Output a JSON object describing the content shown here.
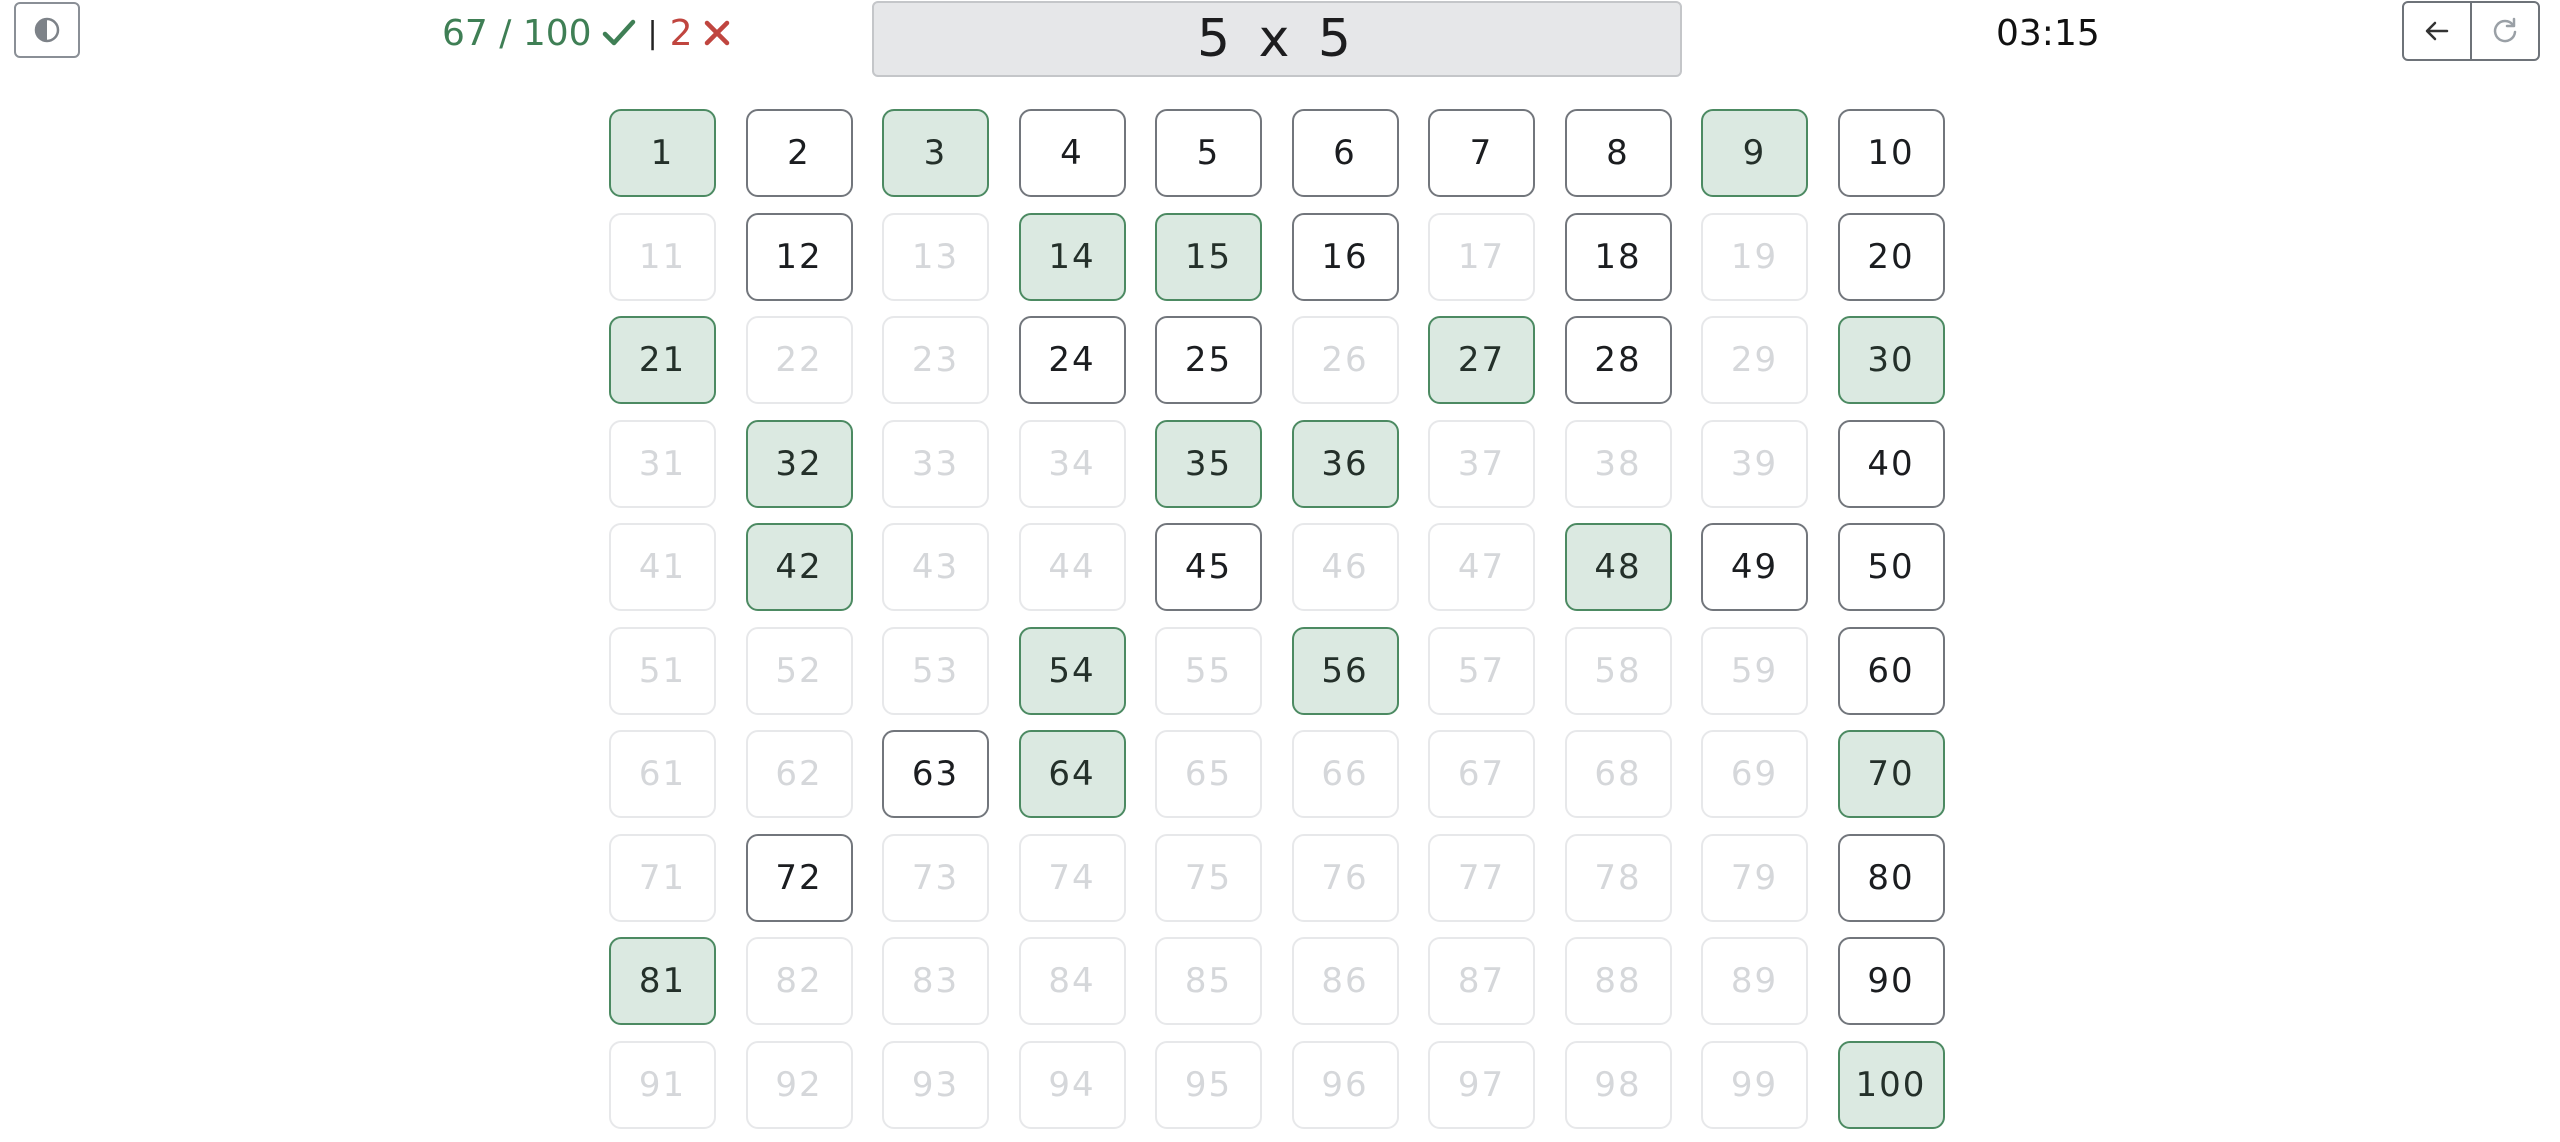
{
  "header": {
    "theme_toggle_icon": "contrast-half-circle-icon",
    "score": {
      "correct": "67 / 100",
      "correct_icon": "checkmark-icon",
      "separator": "|",
      "wrong": "2",
      "wrong_icon": "cross-icon",
      "correct_color": "#3f7f55",
      "wrong_color": "#c0453f"
    },
    "question": "5 x 5",
    "timer": "03:15",
    "back_icon": "arrow-left-icon",
    "restart_icon": "restart-icon"
  },
  "colors": {
    "correct_fill": "#dbe9e1",
    "correct_border": "#4c8a62",
    "available_border": "#72767c",
    "disabled_border": "#e7e8ea",
    "disabled_text": "#d5d7da"
  },
  "grid": {
    "correct_cells": [
      1,
      3,
      9,
      14,
      15,
      21,
      27,
      30,
      32,
      35,
      36,
      42,
      48,
      54,
      56,
      64,
      70,
      81,
      100
    ],
    "available_cells": [
      2,
      4,
      5,
      6,
      7,
      8,
      10,
      12,
      16,
      18,
      20,
      24,
      25,
      28,
      40,
      45,
      49,
      50,
      60,
      63,
      72,
      80,
      90
    ],
    "cells": [
      "1",
      "2",
      "3",
      "4",
      "5",
      "6",
      "7",
      "8",
      "9",
      "10",
      "11",
      "12",
      "13",
      "14",
      "15",
      "16",
      "17",
      "18",
      "19",
      "20",
      "21",
      "22",
      "23",
      "24",
      "25",
      "26",
      "27",
      "28",
      "29",
      "30",
      "31",
      "32",
      "33",
      "34",
      "35",
      "36",
      "37",
      "38",
      "39",
      "40",
      "41",
      "42",
      "43",
      "44",
      "45",
      "46",
      "47",
      "48",
      "49",
      "50",
      "51",
      "52",
      "53",
      "54",
      "55",
      "56",
      "57",
      "58",
      "59",
      "60",
      "61",
      "62",
      "63",
      "64",
      "65",
      "66",
      "67",
      "68",
      "69",
      "70",
      "71",
      "72",
      "73",
      "74",
      "75",
      "76",
      "77",
      "78",
      "79",
      "80",
      "81",
      "82",
      "83",
      "84",
      "85",
      "86",
      "87",
      "88",
      "89",
      "90",
      "91",
      "92",
      "93",
      "94",
      "95",
      "96",
      "97",
      "98",
      "99",
      "100"
    ]
  }
}
